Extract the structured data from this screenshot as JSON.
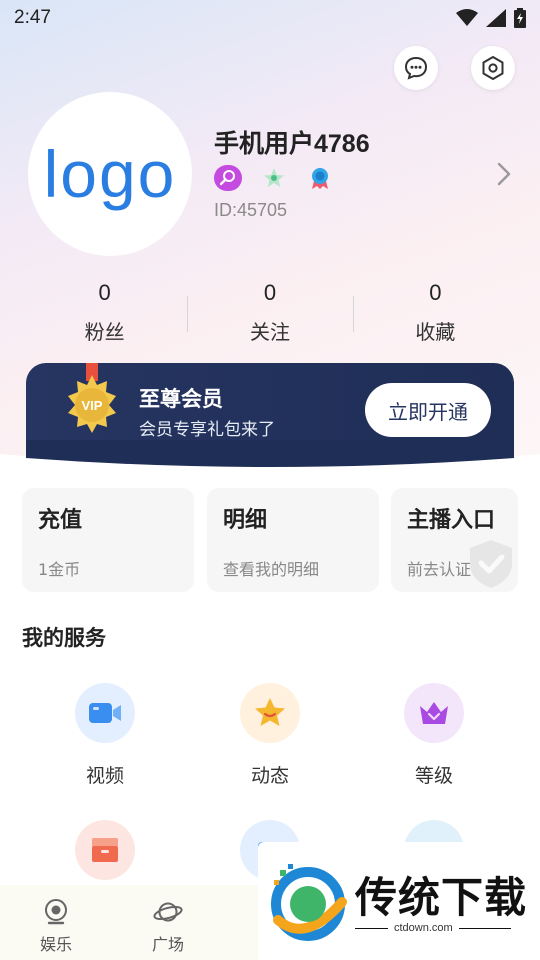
{
  "status_bar": {
    "time": "2:47"
  },
  "profile": {
    "avatar_text": "logo",
    "username": "手机用户4786",
    "user_id": "ID:45705"
  },
  "stats": [
    {
      "count": "0",
      "label": "粉丝"
    },
    {
      "count": "0",
      "label": "关注"
    },
    {
      "count": "0",
      "label": "收藏"
    }
  ],
  "vip": {
    "badge_text": "VIP",
    "title": "至尊会员",
    "subtitle": "会员专享礼包来了",
    "button": "立即开通"
  },
  "cards": [
    {
      "title": "充值",
      "subtitle": "1金币"
    },
    {
      "title": "明细",
      "subtitle": "查看我的明细"
    },
    {
      "title": "主播入口",
      "subtitle": "前去认证"
    }
  ],
  "services": {
    "title": "我的服务",
    "items": [
      {
        "label": "视频",
        "icon": "video-camera-icon",
        "color": "#3a8ef0",
        "bg": "#e3efff"
      },
      {
        "label": "动态",
        "icon": "star-face-icon",
        "color": "#f5b630",
        "bg": "#fff1de"
      },
      {
        "label": "等级",
        "icon": "crown-icon",
        "color": "#a94be2",
        "bg": "#f3e6fb"
      }
    ]
  },
  "tabbar": [
    {
      "label": "娱乐",
      "icon": "webcam-icon"
    },
    {
      "label": "广场",
      "icon": "planet-icon"
    }
  ],
  "watermark": {
    "text": "传统下载",
    "url": "ctdown.com"
  },
  "colors": {
    "vip_bg": "#263561",
    "accent_blue": "#2a7de1",
    "gold": "#f2c94c"
  }
}
